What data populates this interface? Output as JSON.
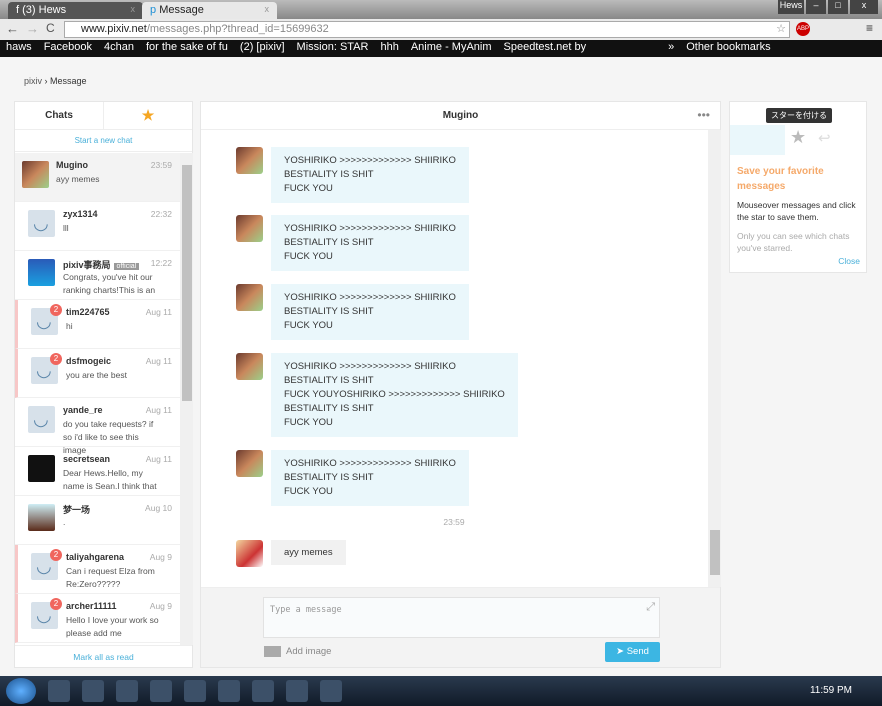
{
  "browser": {
    "tabs": [
      {
        "label": "(3) Hews",
        "icon": "facebook-icon"
      },
      {
        "label": "Message",
        "icon": "pixiv-icon"
      }
    ],
    "user_badge": "Hews",
    "url_host": "www.pixiv.net",
    "url_path": "/messages.php?thread_id=15699632",
    "bookmarks": [
      "haws",
      "Facebook",
      "4chan",
      "for the sake of fu",
      "(2) [pixiv]",
      "Mission: STAR",
      "hhh",
      "Anime - MyAnim",
      "Speedtest.net by",
      "»",
      "Other bookmarks"
    ]
  },
  "breadcrumb": [
    "pixiv",
    "Message"
  ],
  "sidebar": {
    "tab_chats": "Chats",
    "tab_starred": "★",
    "new_chat": "Start a new chat",
    "mark_all": "Mark all as read",
    "items": [
      {
        "name": "Mugino",
        "time": "23:59",
        "preview": "ayy memes",
        "unread": null
      },
      {
        "name": "zyx1314",
        "time": "22:32",
        "preview": "lll",
        "unread": null
      },
      {
        "name": "pixiv事務局",
        "official": "official",
        "time": "12:22",
        "preview": "Congrats, you've hit our ranking charts!This is an",
        "unread": null
      },
      {
        "name": "tim224765",
        "time": "Aug 11",
        "preview": "hi",
        "unread": "2"
      },
      {
        "name": "dsfmogeic",
        "time": "Aug 11",
        "preview": "you are the best",
        "unread": "2"
      },
      {
        "name": "yande_re",
        "time": "Aug 11",
        "preview": "do you take requests? if so i'd like to see this image",
        "unread": null
      },
      {
        "name": "secretsean",
        "time": "Aug 11",
        "preview": "Dear Hews.Hello, my name is Sean.I think that",
        "unread": null
      },
      {
        "name": "梦一场",
        "time": "Aug 10",
        "preview": ".",
        "unread": null
      },
      {
        "name": "taliyahgarena",
        "time": "Aug 9",
        "preview": "Can i request Elza from Re:Zero?????",
        "unread": "2"
      },
      {
        "name": "archer11111",
        "time": "Aug 9",
        "preview": "Hello I love your work so please add me",
        "unread": "2"
      }
    ]
  },
  "chat": {
    "title": "Mugino",
    "more": "•••",
    "messages": [
      "YOSHIRIKO >>>>>>>>>>>>> SHIIRIKO\nBESTIALITY IS SHIT\nFUCK YOU",
      "YOSHIRIKO >>>>>>>>>>>>> SHIIRIKO\nBESTIALITY IS SHIT\nFUCK YOU",
      "YOSHIRIKO >>>>>>>>>>>>> SHIIRIKO\nBESTIALITY IS SHIT\nFUCK YOU",
      "YOSHIRIKO >>>>>>>>>>>>> SHIIRIKO\nBESTIALITY IS SHIT\nFUCK YOUYOSHIRIKO >>>>>>>>>>>>> SHIIRIKO\nBESTIALITY IS SHIT\nFUCK YOU",
      "YOSHIRIKO >>>>>>>>>>>>> SHIIRIKO\nBESTIALITY IS SHIT\nFUCK YOU"
    ],
    "timestamp": "23:59",
    "my_message": "ayy memes",
    "input_placeholder": "Type a message",
    "add_image": "Add image",
    "send": "Send"
  },
  "star_panel": {
    "tooltip": "スターを付ける",
    "title": "Save your favorite messages",
    "desc": "Mouseover messages and click the star to save them.",
    "note": "Only you can see which chats you've starred.",
    "close": "Close"
  },
  "taskbar": {
    "clock": "11:59 PM"
  }
}
